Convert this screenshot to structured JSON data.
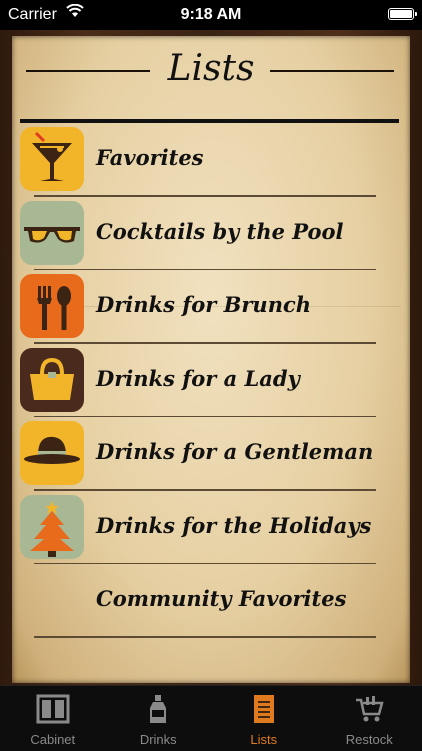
{
  "status_bar": {
    "carrier": "Carrier",
    "time": "9:18 AM"
  },
  "header": {
    "title": "Lists"
  },
  "lists": [
    {
      "label": "Favorites",
      "icon": "martini-glass-icon",
      "icon_bg": "#f2b52a"
    },
    {
      "label": "Cocktails by the Pool",
      "icon": "sunglasses-icon",
      "icon_bg": "#a8b894"
    },
    {
      "label": "Drinks for Brunch",
      "icon": "fork-spoon-icon",
      "icon_bg": "#e86a1b"
    },
    {
      "label": "Drinks for a Lady",
      "icon": "handbag-icon",
      "icon_bg": "#4a2a1c"
    },
    {
      "label": "Drinks for a Gentleman",
      "icon": "fedora-hat-icon",
      "icon_bg": "#f2b52a"
    },
    {
      "label": "Drinks for the Holidays",
      "icon": "christmas-tree-icon",
      "icon_bg": "#a8b894"
    },
    {
      "label": "Community Favorites",
      "icon": "",
      "icon_bg": ""
    }
  ],
  "tabs": [
    {
      "label": "Cabinet",
      "icon": "cabinet-icon",
      "active": false
    },
    {
      "label": "Drinks",
      "icon": "bottle-icon",
      "active": false
    },
    {
      "label": "Lists",
      "icon": "list-book-icon",
      "active": true
    },
    {
      "label": "Restock",
      "icon": "shopping-cart-icon",
      "active": false
    }
  ],
  "colors": {
    "accent": "#e07a1e",
    "tab_inactive": "#8a8a8a"
  }
}
